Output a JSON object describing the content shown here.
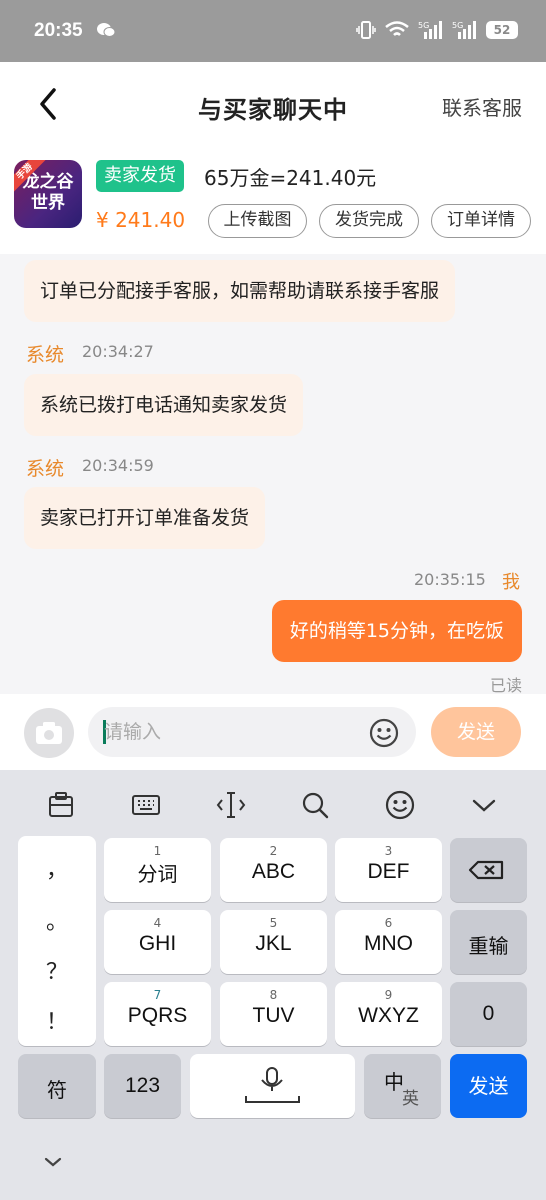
{
  "status_bar": {
    "time": "20:35",
    "battery": "52",
    "icons": [
      "wechat-icon",
      "vibrate-icon",
      "wifi-icon",
      "5g-signal-icon",
      "5g-signal-icon",
      "battery-icon"
    ]
  },
  "header": {
    "title": "与买家聊天中",
    "contact_label": "联系客服",
    "back_icon": "chevron-left-icon"
  },
  "order": {
    "game_name_line1": "龙之谷",
    "game_name_line2": "世界",
    "game_tag": "手游",
    "status_badge": "卖家发货",
    "price": "¥ 241.40",
    "item_desc": "65万金=241.40元",
    "actions": [
      "上传截图",
      "发货完成",
      "订单详情"
    ],
    "colors": {
      "badge": "#1fc28b",
      "price": "#ff7a1a"
    }
  },
  "messages": [
    {
      "sender": "",
      "time": "",
      "text": "订单已分配接手客服，如需帮助请联系接手客服"
    },
    {
      "sender": "系统",
      "time": "20:34:27",
      "text": "系统已拨打电话通知卖家发货"
    },
    {
      "sender": "系统",
      "time": "20:34:59",
      "text": "卖家已打开订单准备发货"
    },
    {
      "sender": "我",
      "time": "20:35:15",
      "text": "好的稍等15分钟，在吃饭",
      "read_status": "已读"
    }
  ],
  "input": {
    "placeholder": "请输入",
    "send_label": "发送",
    "colors": {
      "send_disabled": "#ffc59c",
      "outgoing_bubble": "#ff7a2f"
    }
  },
  "keyboard": {
    "toolbar_icons": [
      "clipboard-icon",
      "keyboard-icon",
      "cursor-move-icon",
      "search-icon",
      "emoji-icon",
      "collapse-chevron-icon"
    ],
    "punctuation": [
      "，",
      "。",
      "？",
      "！"
    ],
    "keys": [
      {
        "num": "1",
        "label": "分词"
      },
      {
        "num": "2",
        "label": "ABC"
      },
      {
        "num": "3",
        "label": "DEF"
      },
      {
        "num": "4",
        "label": "GHI"
      },
      {
        "num": "5",
        "label": "JKL"
      },
      {
        "num": "6",
        "label": "MNO"
      },
      {
        "num": "7",
        "label": "PQRS"
      },
      {
        "num": "8",
        "label": "TUV"
      },
      {
        "num": "9",
        "label": "WXYZ"
      }
    ],
    "right_keys": {
      "retype": "重输",
      "zero": "0"
    },
    "bottom": {
      "symbols": "符",
      "numbers": "123",
      "lang_main": "中",
      "lang_sub": "英",
      "send": "发送"
    },
    "colors": {
      "send": "#0c6bf2"
    }
  }
}
